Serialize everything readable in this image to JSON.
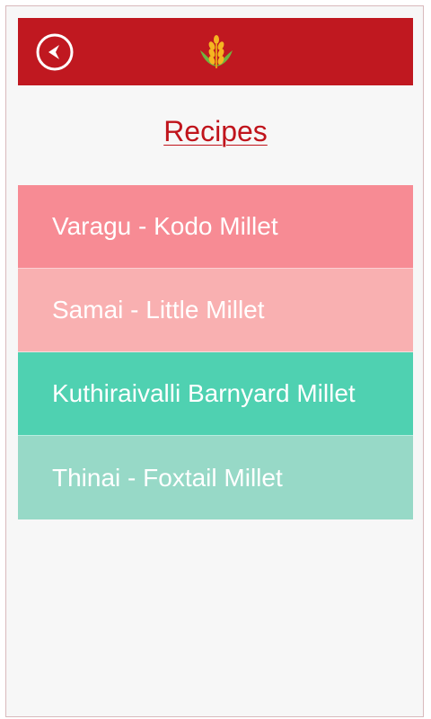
{
  "header": {
    "back_icon": "back-arrow-icon",
    "logo_icon": "wheat-logo-icon",
    "background_color": "#c01820"
  },
  "page": {
    "title": "Recipes"
  },
  "recipes": [
    {
      "label": "Varagu - Kodo Millet",
      "color": "#f78b94"
    },
    {
      "label": "Samai - Little Millet",
      "color": "#f9b0b1"
    },
    {
      "label": "Kuthiraivalli Barnyard Millet",
      "color": "#4fd1b1"
    },
    {
      "label": "Thinai - Foxtail Millet",
      "color": "#97d9c7"
    }
  ]
}
